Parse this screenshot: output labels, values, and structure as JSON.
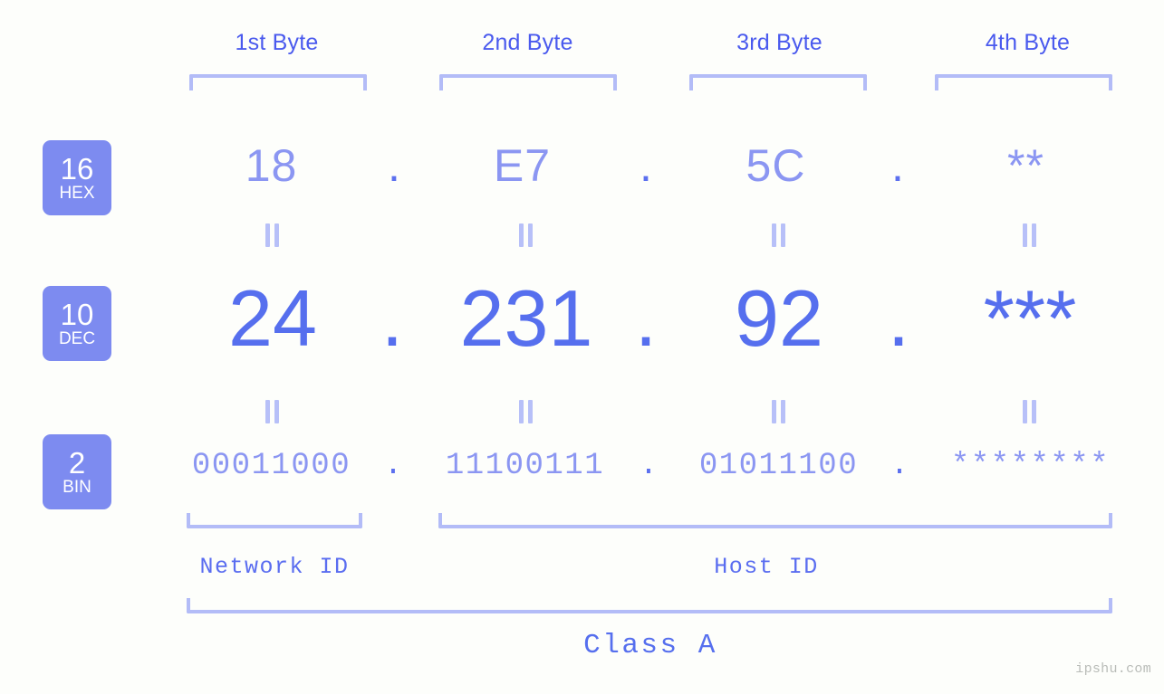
{
  "background_color": "#fdfefb",
  "colors": {
    "header_blue": "#4a5aee",
    "bracket_blue": "#b3bcf7",
    "badge_blue": "#7d8bf0",
    "hex_blue": "#8b96f2",
    "dec_blue": "#566fee",
    "bin_blue": "#8b96f2",
    "label_blue": "#5a6df0",
    "watermark_gray": "#b9bcb8"
  },
  "byte_headers": [
    {
      "label": "1st Byte"
    },
    {
      "label": "2nd Byte"
    },
    {
      "label": "3rd Byte"
    },
    {
      "label": "4th Byte"
    }
  ],
  "bases": [
    {
      "number": "16",
      "name": "HEX"
    },
    {
      "number": "10",
      "name": "DEC"
    },
    {
      "number": "2",
      "name": "BIN"
    }
  ],
  "rows": {
    "hex": {
      "base_number": "16",
      "base_name": "HEX",
      "values": [
        "18",
        "E7",
        "5C",
        "**"
      ],
      "separators": [
        ".",
        ".",
        "."
      ]
    },
    "dec": {
      "base_number": "10",
      "base_name": "DEC",
      "values": [
        "24",
        "231",
        "92",
        "***"
      ],
      "separators": [
        ".",
        ".",
        "."
      ]
    },
    "bin": {
      "base_number": "2",
      "base_name": "BIN",
      "values": [
        "00011000",
        "11100111",
        "01011100",
        "********"
      ],
      "separators": [
        ".",
        ".",
        "."
      ]
    }
  },
  "equality_marks": {
    "symbol": "=",
    "count_per_row": 4,
    "rows": 2
  },
  "id_labels": {
    "network": "Network ID",
    "host": "Host ID"
  },
  "class_label": "Class A",
  "watermark": "ipshu.com"
}
